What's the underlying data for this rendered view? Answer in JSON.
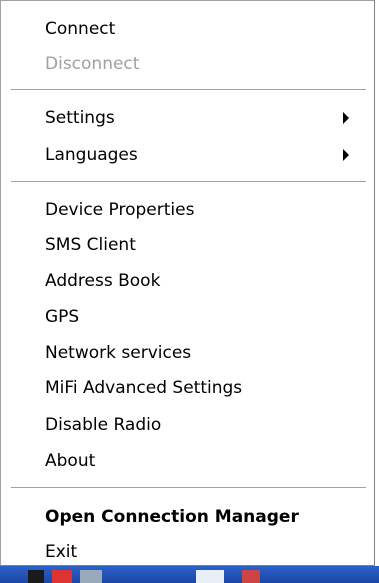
{
  "menu": {
    "items": [
      {
        "label": "Connect",
        "enabled": true
      },
      {
        "label": "Disconnect",
        "enabled": false
      },
      {
        "label": "Settings",
        "enabled": true,
        "submenu": true
      },
      {
        "label": "Languages",
        "enabled": true,
        "submenu": true
      },
      {
        "label": "Device Properties",
        "enabled": true
      },
      {
        "label": "SMS Client",
        "enabled": true
      },
      {
        "label": "Address Book",
        "enabled": true
      },
      {
        "label": "GPS",
        "enabled": true
      },
      {
        "label": "Network services",
        "enabled": true
      },
      {
        "label": "MiFi Advanced Settings",
        "enabled": true
      },
      {
        "label": "Disable Radio",
        "enabled": true
      },
      {
        "label": "About",
        "enabled": true
      },
      {
        "label": "Open Connection Manager",
        "enabled": true,
        "default": true
      },
      {
        "label": "Exit",
        "enabled": true
      }
    ],
    "submenu_icon": "triangle-right-icon",
    "colors": {
      "text": "#000000",
      "disabled_text": "#a0a0a0",
      "background": "#ffffff",
      "separator": "#a0a0a0"
    }
  },
  "taskbar": {
    "color": "#2456bd",
    "icons": [
      "tray-app-icon-1",
      "tray-app-icon-2",
      "tray-app-icon-3",
      "tray-app-icon-4",
      "tray-app-icon-5"
    ]
  }
}
